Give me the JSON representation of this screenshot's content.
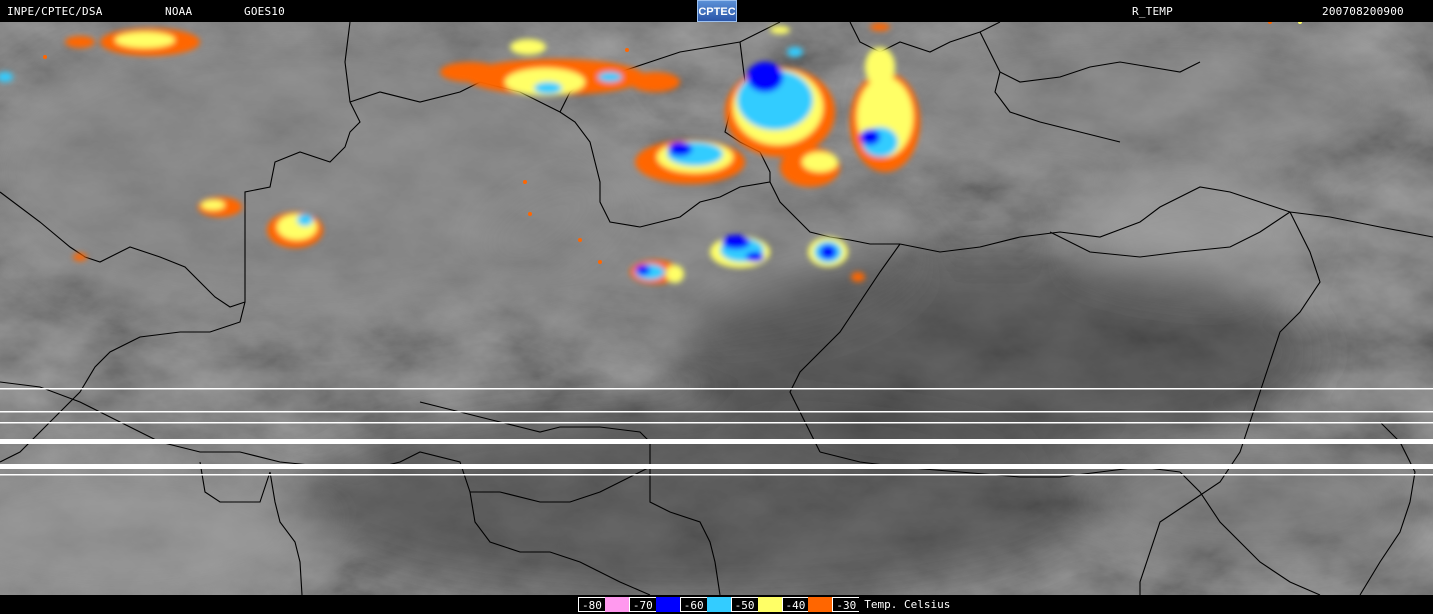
{
  "header": {
    "source": "INPE/CPTEC/DSA",
    "agency": "NOAA",
    "satellite": "GOES10",
    "logo_text": "CPTEC",
    "product": "R_TEMP",
    "timestamp": "200708200900"
  },
  "legend": {
    "entries": [
      {
        "label": "-80",
        "color": "#ff99ee"
      },
      {
        "label": "-70",
        "color": "#0000ff"
      },
      {
        "label": "-60",
        "color": "#33ccff"
      },
      {
        "label": "-50",
        "color": "#ffff66"
      },
      {
        "label": "-40",
        "color": "#ff6600"
      },
      {
        "label": "-30",
        "color": "#000000"
      }
    ],
    "unit": "Temp. Celsius"
  },
  "colors": {
    "background": "#000000",
    "border_lines": "#000000",
    "scan_line_artifacts": "#ffffff"
  }
}
